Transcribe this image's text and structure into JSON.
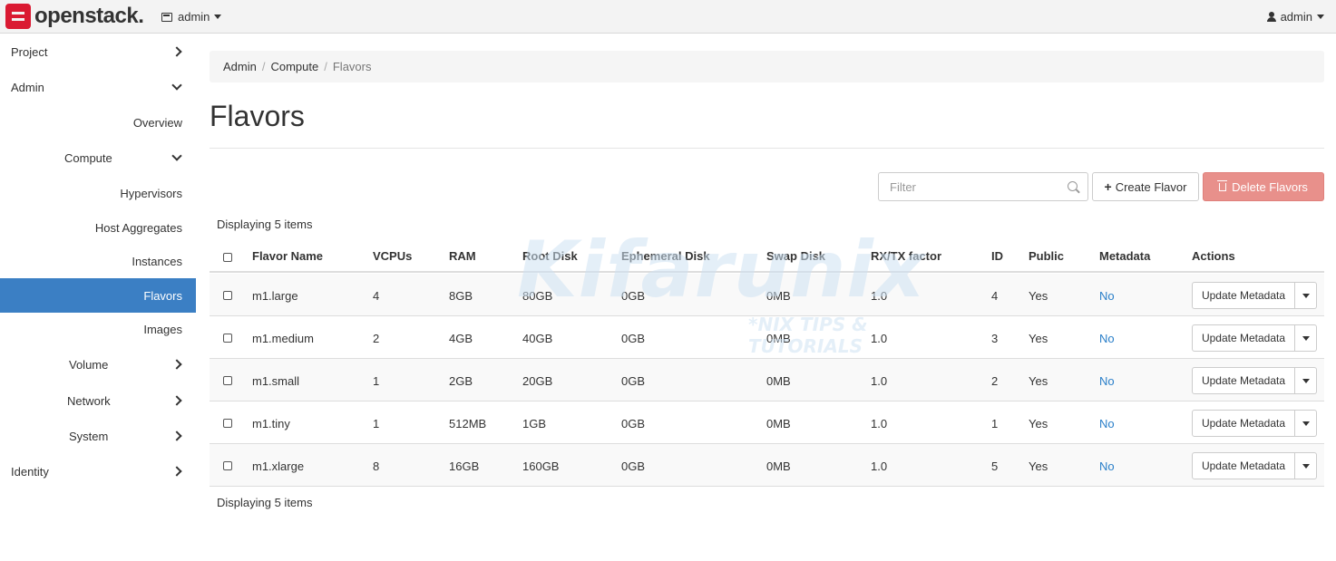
{
  "brand": {
    "name": "openstack."
  },
  "topbar": {
    "project": "admin",
    "user": "admin"
  },
  "sidebar": {
    "items": [
      {
        "label": "Project"
      },
      {
        "label": "Admin"
      },
      {
        "label": "Overview"
      },
      {
        "label": "Compute"
      },
      {
        "label": "Hypervisors"
      },
      {
        "label": "Host Aggregates"
      },
      {
        "label": "Instances"
      },
      {
        "label": "Flavors"
      },
      {
        "label": "Images"
      },
      {
        "label": "Volume"
      },
      {
        "label": "Network"
      },
      {
        "label": "System"
      },
      {
        "label": "Identity"
      }
    ]
  },
  "breadcrumb": {
    "admin": "Admin",
    "compute": "Compute",
    "current": "Flavors",
    "sep": "/"
  },
  "page": {
    "title": "Flavors"
  },
  "toolbar": {
    "filter_placeholder": "Filter",
    "create_label": "Create Flavor",
    "delete_label": "Delete Flavors"
  },
  "table": {
    "count_text": "Displaying 5 items",
    "headers": [
      "Flavor Name",
      "VCPUs",
      "RAM",
      "Root Disk",
      "Ephemeral Disk",
      "Swap Disk",
      "RX/TX factor",
      "ID",
      "Public",
      "Metadata",
      "Actions"
    ],
    "rows": [
      {
        "name": "m1.large",
        "vcpus": "4",
        "ram": "8GB",
        "root": "80GB",
        "ephemeral": "0GB",
        "swap": "0MB",
        "rxtx": "1.0",
        "id": "4",
        "public": "Yes",
        "metadata": "No",
        "action": "Update Metadata"
      },
      {
        "name": "m1.medium",
        "vcpus": "2",
        "ram": "4GB",
        "root": "40GB",
        "ephemeral": "0GB",
        "swap": "0MB",
        "rxtx": "1.0",
        "id": "3",
        "public": "Yes",
        "metadata": "No",
        "action": "Update Metadata"
      },
      {
        "name": "m1.small",
        "vcpus": "1",
        "ram": "2GB",
        "root": "20GB",
        "ephemeral": "0GB",
        "swap": "0MB",
        "rxtx": "1.0",
        "id": "2",
        "public": "Yes",
        "metadata": "No",
        "action": "Update Metadata"
      },
      {
        "name": "m1.tiny",
        "vcpus": "1",
        "ram": "512MB",
        "root": "1GB",
        "ephemeral": "0GB",
        "swap": "0MB",
        "rxtx": "1.0",
        "id": "1",
        "public": "Yes",
        "metadata": "No",
        "action": "Update Metadata"
      },
      {
        "name": "m1.xlarge",
        "vcpus": "8",
        "ram": "16GB",
        "root": "160GB",
        "ephemeral": "0GB",
        "swap": "0MB",
        "rxtx": "1.0",
        "id": "5",
        "public": "Yes",
        "metadata": "No",
        "action": "Update Metadata"
      }
    ]
  },
  "watermark": {
    "text": "Kifarunix",
    "tagline": "*NIX TIPS & TUTORIALS"
  },
  "colors": {
    "active_nav": "#3b7fc4",
    "danger": "#e8908b",
    "link": "#2a7fc9",
    "brand_red": "#da1a32"
  }
}
